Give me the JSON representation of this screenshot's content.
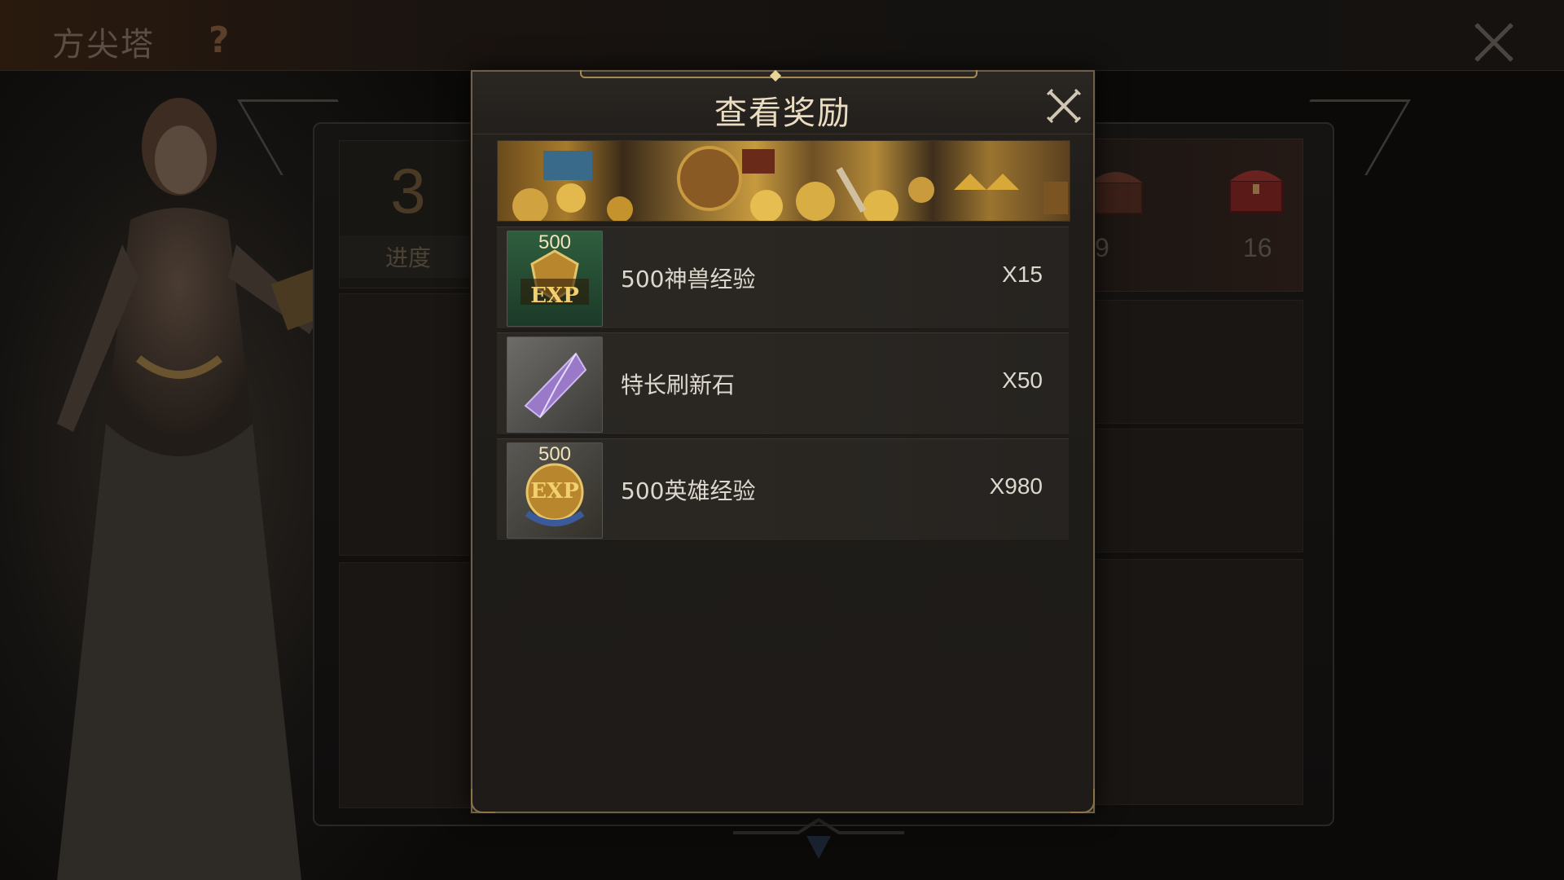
{
  "background": {
    "title": "方尖塔",
    "help_icon": "?",
    "progress": {
      "value": "3",
      "label": "进度"
    },
    "ticks": [
      "9",
      "16"
    ]
  },
  "modal": {
    "title": "查看奖励",
    "rewards": [
      {
        "name": "500神兽经验",
        "qty": "X15",
        "badge": "500",
        "icon": "beast-exp-icon",
        "icon_text": "EXP"
      },
      {
        "name": "特长刷新石",
        "qty": "X50",
        "badge": "",
        "icon": "purple-crystal-icon",
        "icon_text": ""
      },
      {
        "name": "500英雄经验",
        "qty": "X980",
        "badge": "500",
        "icon": "hero-exp-icon",
        "icon_text": "EXP"
      }
    ]
  },
  "colors": {
    "accent_gold": "#a68a55",
    "panel_bg": "#1e1b18",
    "text": "#ddd8ce"
  }
}
